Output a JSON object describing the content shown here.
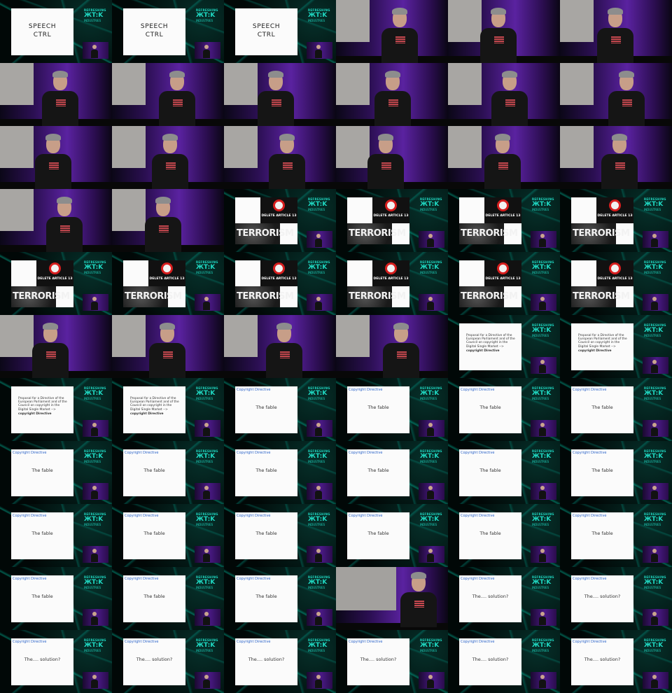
{
  "grid": {
    "columns": 6,
    "rows": 11
  },
  "badge": {
    "top": "REFRESHING",
    "mid": "ЖT:K",
    "bottom": "INDUSTRIES"
  },
  "slides": {
    "speech": {
      "line1": "SPEECH",
      "line2": "CTRL"
    },
    "terror": {
      "banner": "DELETE ARTICLE 13",
      "word": "TERRORISM"
    },
    "proposal": {
      "text": "Proposal for a Directive of the European Parliament and of the Council on copyright in the Digital Single Market --> ",
      "bold": "copyright Directive"
    },
    "fable": {
      "head": "Copyright Directive",
      "body": "The fable"
    },
    "solution": {
      "head": "Copyright Directive",
      "body": "The.... solution?"
    }
  },
  "cells": [
    "speech",
    "speech",
    "speech",
    "stage",
    "stage",
    "stage",
    "stage",
    "stage",
    "stage",
    "stage",
    "stage",
    "stage",
    "stage",
    "stage",
    "stage",
    "stage",
    "stage",
    "stage",
    "stage",
    "stage",
    "terror",
    "terror",
    "terror",
    "terror",
    "terror",
    "terror",
    "terror",
    "terror",
    "terror",
    "terror",
    "stage",
    "stage",
    "stage",
    "stage",
    "proposal",
    "proposal",
    "proposal",
    "proposal",
    "fable",
    "fable",
    "fable",
    "fable",
    "fable",
    "fable",
    "fable",
    "fable",
    "fable",
    "fable",
    "fable",
    "fable",
    "fable",
    "fable",
    "fable",
    "fable",
    "fable",
    "fable",
    "fable",
    "stagebig",
    "solution",
    "solution",
    "solution",
    "solution",
    "solution",
    "solution",
    "solution",
    "solution"
  ]
}
